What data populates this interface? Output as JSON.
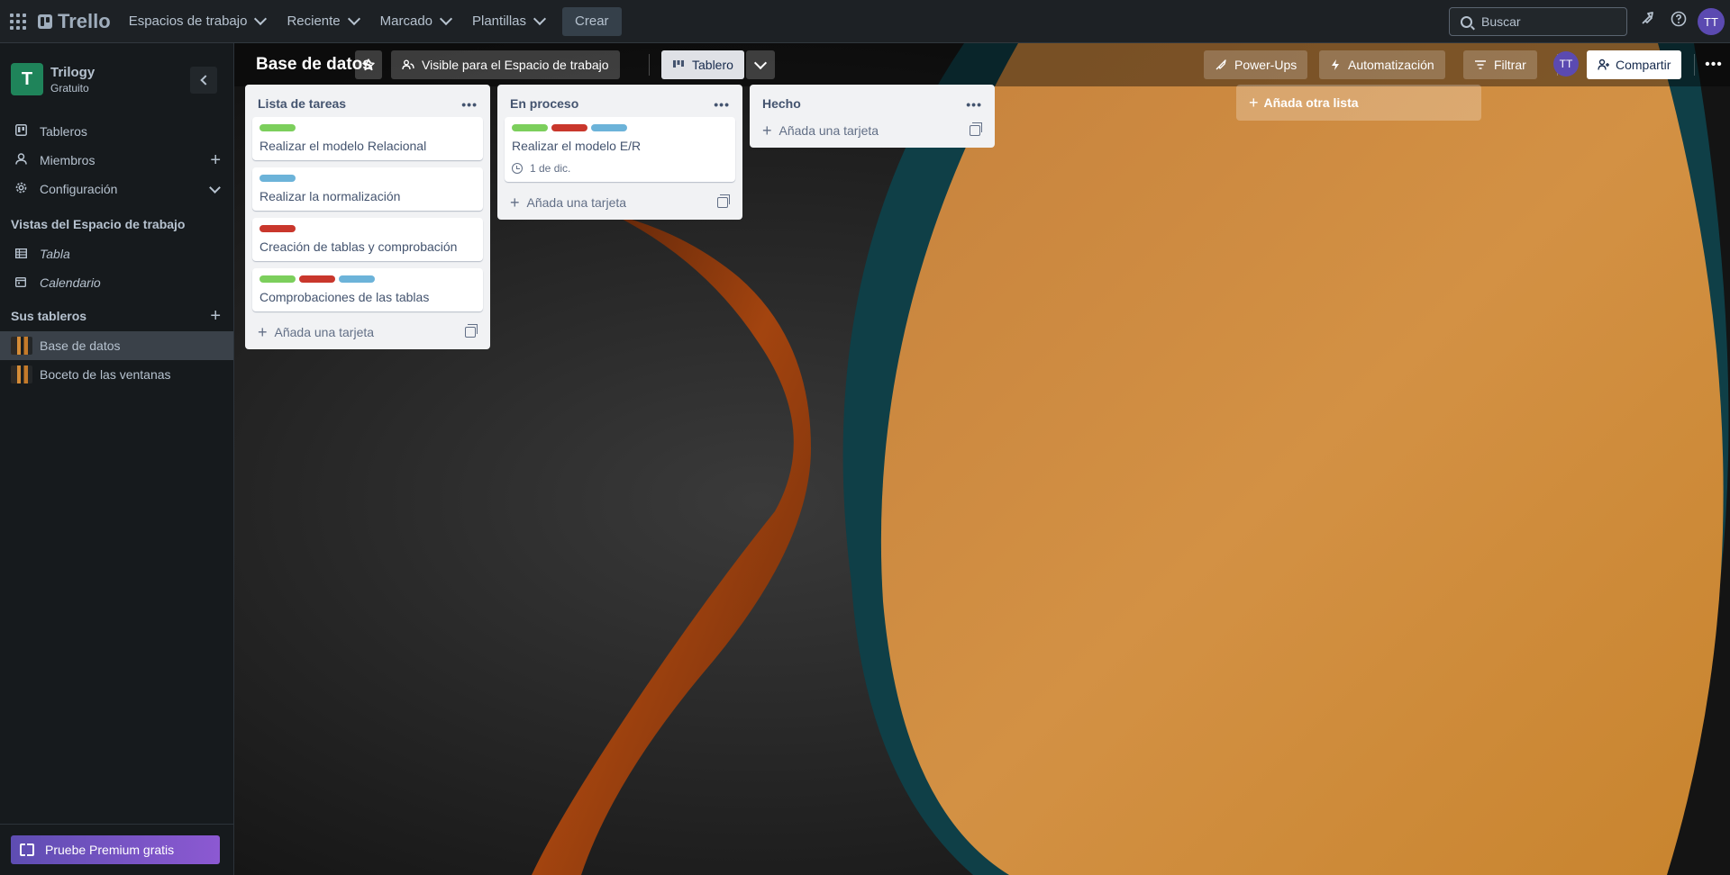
{
  "topbar": {
    "brand": "Trello",
    "menu": [
      {
        "label": "Espacios de trabajo"
      },
      {
        "label": "Reciente"
      },
      {
        "label": "Marcado"
      },
      {
        "label": "Plantillas"
      }
    ],
    "create_label": "Crear",
    "search_placeholder": "Buscar",
    "avatar_initials": "TT"
  },
  "sidebar": {
    "workspace": {
      "initial": "T",
      "name": "Trilogy",
      "plan": "Gratuito"
    },
    "items": [
      {
        "label": "Tableros",
        "icon": "board-icon"
      },
      {
        "label": "Miembros",
        "icon": "person-icon"
      },
      {
        "label": "Configuración",
        "icon": "gear-icon"
      }
    ],
    "views_heading": "Vistas del Espacio de trabajo",
    "views": [
      {
        "label": "Tabla",
        "icon": "table-icon"
      },
      {
        "label": "Calendario",
        "icon": "calendar-icon"
      }
    ],
    "boards_heading": "Sus tableros",
    "boards": [
      {
        "label": "Base de datos",
        "active": true
      },
      {
        "label": "Boceto de las ventanas",
        "active": false
      }
    ],
    "premium_label": "Pruebe Premium gratis"
  },
  "board": {
    "title": "Base de datos",
    "visibility_label": "Visible para el Espacio de trabajo",
    "view_label": "Tablero",
    "powerups_label": "Power-Ups",
    "automation_label": "Automatización",
    "filter_label": "Filtrar",
    "member_initials": "TT",
    "share_label": "Compartir",
    "add_list_label": "Añada otra lista",
    "add_card_label": "Añada una tarjeta",
    "lists": [
      {
        "title": "Lista de tareas",
        "cards": [
          {
            "title": "Realizar el modelo Relacional",
            "labels": [
              "#7ccf5c"
            ]
          },
          {
            "title": "Realizar la normalización",
            "labels": [
              "#6cb3d9"
            ]
          },
          {
            "title": "Creación de tablas y comprobación",
            "labels": [
              "#c9372c"
            ]
          },
          {
            "title": "Comprobaciones de las tablas",
            "labels": [
              "#7ccf5c",
              "#c9372c",
              "#6cb3d9"
            ]
          }
        ]
      },
      {
        "title": "En proceso",
        "cards": [
          {
            "title": "Realizar el modelo E/R",
            "labels": [
              "#7ccf5c",
              "#c9372c",
              "#6cb3d9"
            ],
            "due": "1 de dic."
          }
        ]
      },
      {
        "title": "Hecho",
        "cards": []
      }
    ]
  },
  "colors": {
    "accent": "#5b4ab1",
    "workspace_logo": "#1f845a"
  }
}
